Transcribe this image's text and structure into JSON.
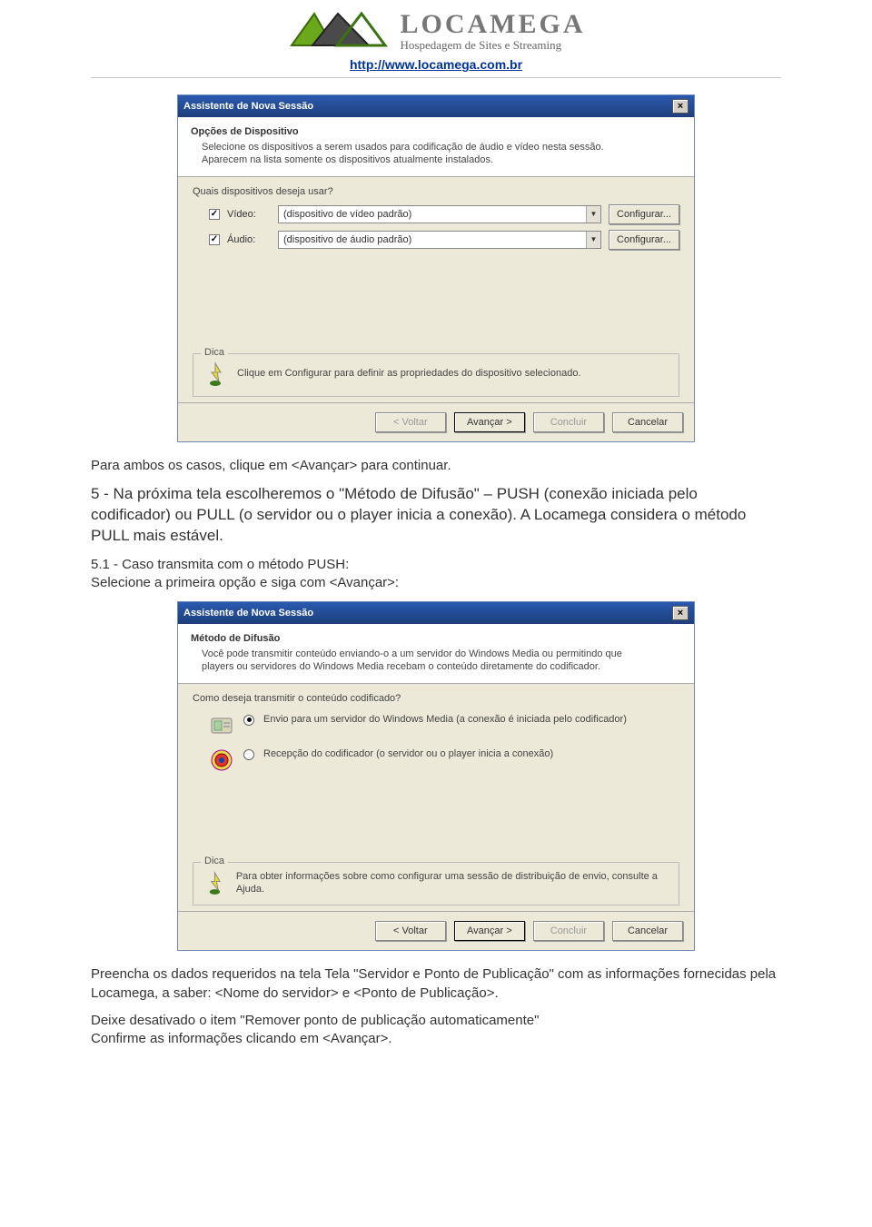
{
  "header": {
    "logo_title": "LOCAMEGA",
    "logo_sub": "Hospedagem de Sites e Streaming",
    "site_url": "http://www.locamega.com.br"
  },
  "shot1": {
    "title": "Assistente de Nova Sessão",
    "h_title": "Opções de Dispositivo",
    "h_desc": "Selecione os dispositivos a serem usados para codificação de áudio e vídeo nesta sessão. Aparecem na lista somente os dispositivos atualmente instalados.",
    "q_label": "Quais dispositivos deseja usar?",
    "video_label": "Vídeo:",
    "video_value": "(dispositivo de vídeo padrão)",
    "audio_label": "Áudio:",
    "audio_value": "(dispositivo de áudio padrão)",
    "configure_btn": "Configurar...",
    "tip_legend": "Dica",
    "tip_text": "Clique em Configurar para definir as propriedades do dispositivo selecionado.",
    "btn_back": "< Voltar",
    "btn_next": "Avançar >",
    "btn_finish": "Concluir",
    "btn_cancel": "Cancelar"
  },
  "para1": "Para ambos os casos, clique em <Avançar> para continuar.",
  "para2": "5 - Na próxima tela escolheremos o \"Método de Difusão\" – PUSH (conexão iniciada pelo codificador) ou PULL (o servidor ou o player inicia a conexão). A Locamega considera o método PULL mais estável.",
  "para3": "5.1 - Caso transmita com o método PUSH:",
  "para4": "Selecione a primeira opção e siga com <Avançar>:",
  "shot2": {
    "title": "Assistente de Nova Sessão",
    "h_title": "Método de Difusão",
    "h_desc": "Você pode transmitir conteúdo enviando-o a um servidor do Windows Media ou permitindo que players ou servidores do Windows Media recebam o conteúdo diretamente do codificador.",
    "q_label": "Como deseja transmitir o conteúdo codificado?",
    "opt1": "Envio para um servidor do Windows Media (a conexão é iniciada pelo codificador)",
    "opt2": "Recepção do codificador (o servidor ou o player inicia a conexão)",
    "tip_legend": "Dica",
    "tip_text": "Para obter informações sobre como configurar uma sessão de distribuição de envio, consulte a Ajuda.",
    "btn_back": "< Voltar",
    "btn_next": "Avançar >",
    "btn_finish": "Concluir",
    "btn_cancel": "Cancelar"
  },
  "para5": "Preencha os dados requeridos na tela Tela \"Servidor e Ponto de Publicação\" com as informações fornecidas pela Locamega, a saber: <Nome do servidor> e <Ponto de Publicação>.",
  "para6": "Deixe desativado o item \"Remover ponto de publicação automaticamente\"",
  "para7": "Confirme as informações clicando em <Avançar>."
}
